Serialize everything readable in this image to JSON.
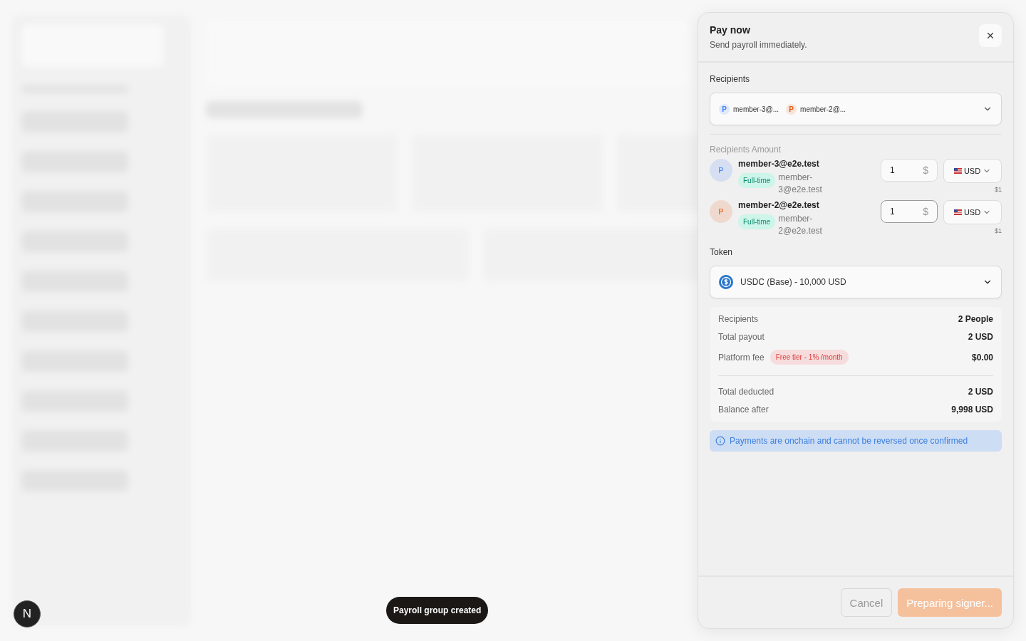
{
  "drawer": {
    "title": "Pay now",
    "subtitle": "Send payroll immediately.",
    "recipients": {
      "label": "Recipients",
      "chips": [
        {
          "initial": "P",
          "label": "member-3@...",
          "color": "#3b82f6"
        },
        {
          "initial": "P",
          "label": "member-2@...",
          "color": "#ea580c"
        }
      ]
    },
    "amounts": {
      "label": "Recipients Amount",
      "rows": [
        {
          "initial": "P",
          "color": "#3b82f6",
          "email": "member-3@e2e.test",
          "tag": "Full-time",
          "secondary": "member-3@e2e.test",
          "amount": "1",
          "symbol": "$",
          "currency": "USD",
          "converted": "$1",
          "focused": false
        },
        {
          "initial": "P",
          "color": "#ea580c",
          "email": "member-2@e2e.test",
          "tag": "Full-time",
          "secondary": "member-2@e2e.test",
          "amount": "1",
          "symbol": "$",
          "currency": "USD",
          "converted": "$1",
          "focused": true
        }
      ]
    },
    "token": {
      "label": "Token",
      "value": "USDC (Base) - 10,000 USD"
    },
    "summary": {
      "rows": [
        {
          "label": "Recipients",
          "value": "2 People"
        },
        {
          "label": "Total payout",
          "value": "2 USD"
        },
        {
          "label": "Platform fee",
          "badge": "Free tier - 1% /month",
          "value": "$0.00"
        }
      ],
      "totals": [
        {
          "label": "Total deducted",
          "value": "2 USD"
        },
        {
          "label": "Balance after",
          "value": "9,998 USD"
        }
      ]
    },
    "notice": "Payments are onchain and cannot be reversed once confirmed",
    "cancel": {
      "label": "Cancel",
      "disabled": true
    },
    "confirm": {
      "label": "Preparing signer...",
      "disabled": true
    }
  },
  "toast": "Payroll group created",
  "dev_badge": "N"
}
